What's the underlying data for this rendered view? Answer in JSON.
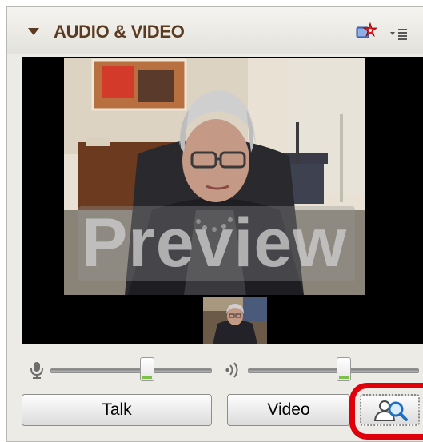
{
  "panel": {
    "title": "AUDIO & VIDEO",
    "header_icons": [
      "collapse-caret-icon",
      "settings-star-icon",
      "options-menu-icon"
    ]
  },
  "video": {
    "overlay_text": "Preview",
    "has_self_thumbnail": true
  },
  "audio": {
    "icons": [
      "microphone-icon",
      "speaker-icon"
    ],
    "mic_level": 0.62,
    "speaker_level": 0.63,
    "level_color": "#7cc04a"
  },
  "buttons": {
    "talk_label": "Talk",
    "video_label": "Video",
    "search_icon": "people-search-icon"
  },
  "highlight_color": "#e0000b"
}
